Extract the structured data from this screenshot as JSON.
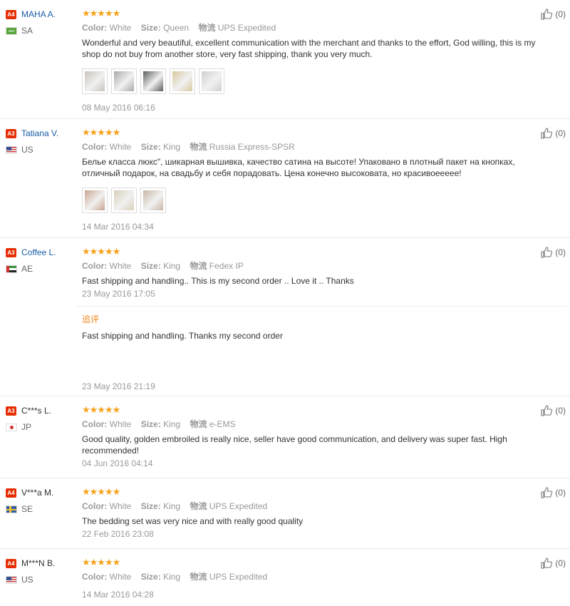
{
  "labels": {
    "color": "Color:",
    "size": "Size:",
    "shipping": "物流"
  },
  "reviews": [
    {
      "badge": "A4",
      "name": "MAHA A.",
      "name_link": true,
      "country": "SA",
      "flag": "sa",
      "stars": "★★★★★",
      "color": "White",
      "size": "Queen",
      "shipping": "UPS Expedited",
      "text": "Wonderful and very beautiful, excellent communication with the merchant and thanks to the effort, God willing, this is my shop do not buy from another store, very fast shipping, thank you very much.",
      "photos": [
        "#c8c4bc",
        "#a9a9a9",
        "#5b5d5e",
        "#d8c9a0",
        "#cfcfcf"
      ],
      "date": "08 May 2016 06:16",
      "likes": "(0)"
    },
    {
      "badge": "A3",
      "name": "Tatiana V.",
      "name_link": true,
      "country": "US",
      "flag": "us",
      "stars": "★★★★★",
      "color": "White",
      "size": "King",
      "shipping": "Russia Express-SPSR",
      "text": "Белье класса люкс\", шикарная вышивка, качество сатина на высоте! Упаковано в плотный пакет на кнопках, отличный подарок, на свадьбу и себя порадовать. Цена конечно высоковата, но красивоеееее!",
      "photos": [
        "#c9a58f",
        "#d7cfb8",
        "#c8b7a6"
      ],
      "date": "14 Mar 2016 04:34",
      "likes": "(0)"
    },
    {
      "badge": "A3",
      "name": "Coffee L.",
      "name_link": true,
      "country": "AE",
      "flag": "ae",
      "stars": "★★★★★",
      "color": "White",
      "size": "King",
      "shipping": "Fedex IP",
      "text": "Fast shipping and handling.. This is my second order .. Love it .. Thanks",
      "date": "23 May 2016 17:05",
      "followup_label": "追评",
      "followup_text": "Fast shipping and handling. Thanks my second order",
      "followup_date": "23 May 2016 21:19",
      "likes": "(0)"
    },
    {
      "badge": "A3",
      "name": "C***s L.",
      "name_link": false,
      "country": "JP",
      "flag": "jp",
      "stars": "★★★★★",
      "color": "White",
      "size": "King",
      "shipping": "e-EMS",
      "text": "Good quality, golden embroiled is really nice, seller have good communication, and delivery was super fast. High recommended!",
      "date": "04 Jun 2016 04:14",
      "likes": "(0)"
    },
    {
      "badge": "A4",
      "name": "V***a M.",
      "name_link": false,
      "country": "SE",
      "flag": "se",
      "stars": "★★★★★",
      "color": "White",
      "size": "King",
      "shipping": "UPS Expedited",
      "text": "The bedding set was very nice and with really good quality",
      "date": "22 Feb 2016 23:08",
      "likes": "(0)"
    },
    {
      "badge": "A4",
      "name": "M***N B.",
      "name_link": false,
      "country": "US",
      "flag": "us",
      "stars": "★★★★★",
      "color": "White",
      "size": "King",
      "shipping": "UPS Expedited",
      "text": "",
      "date": "14 Mar 2016 04:28",
      "likes": "(0)"
    }
  ]
}
